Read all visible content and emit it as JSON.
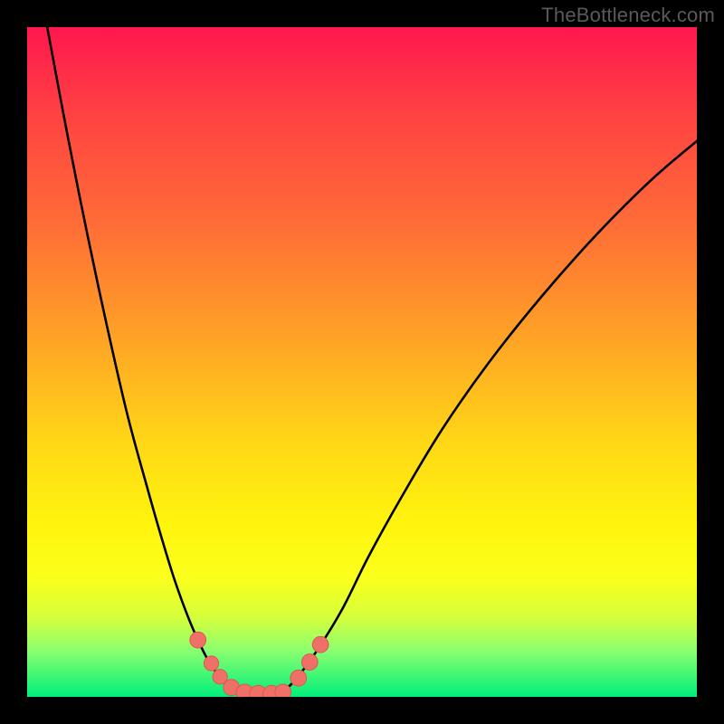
{
  "watermark": "TheBottleneck.com",
  "background": "#000000",
  "gradient_colors": [
    "#ff174e",
    "#ff3f43",
    "#ff6e36",
    "#ffa824",
    "#ffd716",
    "#fff40e",
    "#fbff1b",
    "#d7ff3a",
    "#8cff6f",
    "#00ef7a"
  ],
  "chart_data": {
    "type": "line",
    "title": "",
    "xlabel": "",
    "ylabel": "",
    "x_range": [
      0,
      100
    ],
    "y_range": [
      0,
      100
    ],
    "grid": false,
    "series": [
      {
        "name": "left-curve",
        "x": [
          3,
          6,
          9,
          12,
          15,
          18,
          20,
          22,
          24,
          25.5,
          27,
          28.5,
          30,
          32
        ],
        "y": [
          100,
          84,
          69,
          55,
          42,
          31,
          24,
          17.5,
          12,
          8.5,
          5.5,
          3.3,
          1.7,
          0.6
        ]
      },
      {
        "name": "right-curve",
        "x": [
          38,
          40,
          43,
          47,
          51,
          56,
          62,
          69,
          77,
          85,
          93,
          100
        ],
        "y": [
          0.6,
          2.5,
          6.5,
          13,
          21,
          30,
          40,
          50,
          60,
          69,
          77,
          83
        ]
      }
    ],
    "markers": [
      {
        "series": "left-curve",
        "x": 25.5,
        "y": 8.5,
        "r": 1.2
      },
      {
        "series": "left-curve",
        "x": 27.5,
        "y": 5.0,
        "r": 1.1
      },
      {
        "series": "left-curve",
        "x": 28.8,
        "y": 3.0,
        "r": 1.1
      },
      {
        "series": "left-curve",
        "x": 30.5,
        "y": 1.4,
        "r": 1.2
      },
      {
        "series": "left-curve",
        "x": 32.5,
        "y": 0.6,
        "r": 1.3
      },
      {
        "series": "left-curve",
        "x": 34.5,
        "y": 0.4,
        "r": 1.3
      },
      {
        "series": "right-curve",
        "x": 36.5,
        "y": 0.4,
        "r": 1.3
      },
      {
        "series": "right-curve",
        "x": 38.2,
        "y": 0.7,
        "r": 1.2
      },
      {
        "series": "right-curve",
        "x": 40.5,
        "y": 2.8,
        "r": 1.2
      },
      {
        "series": "right-curve",
        "x": 42.2,
        "y": 5.2,
        "r": 1.2
      },
      {
        "series": "right-curve",
        "x": 43.8,
        "y": 7.8,
        "r": 1.2
      }
    ]
  }
}
